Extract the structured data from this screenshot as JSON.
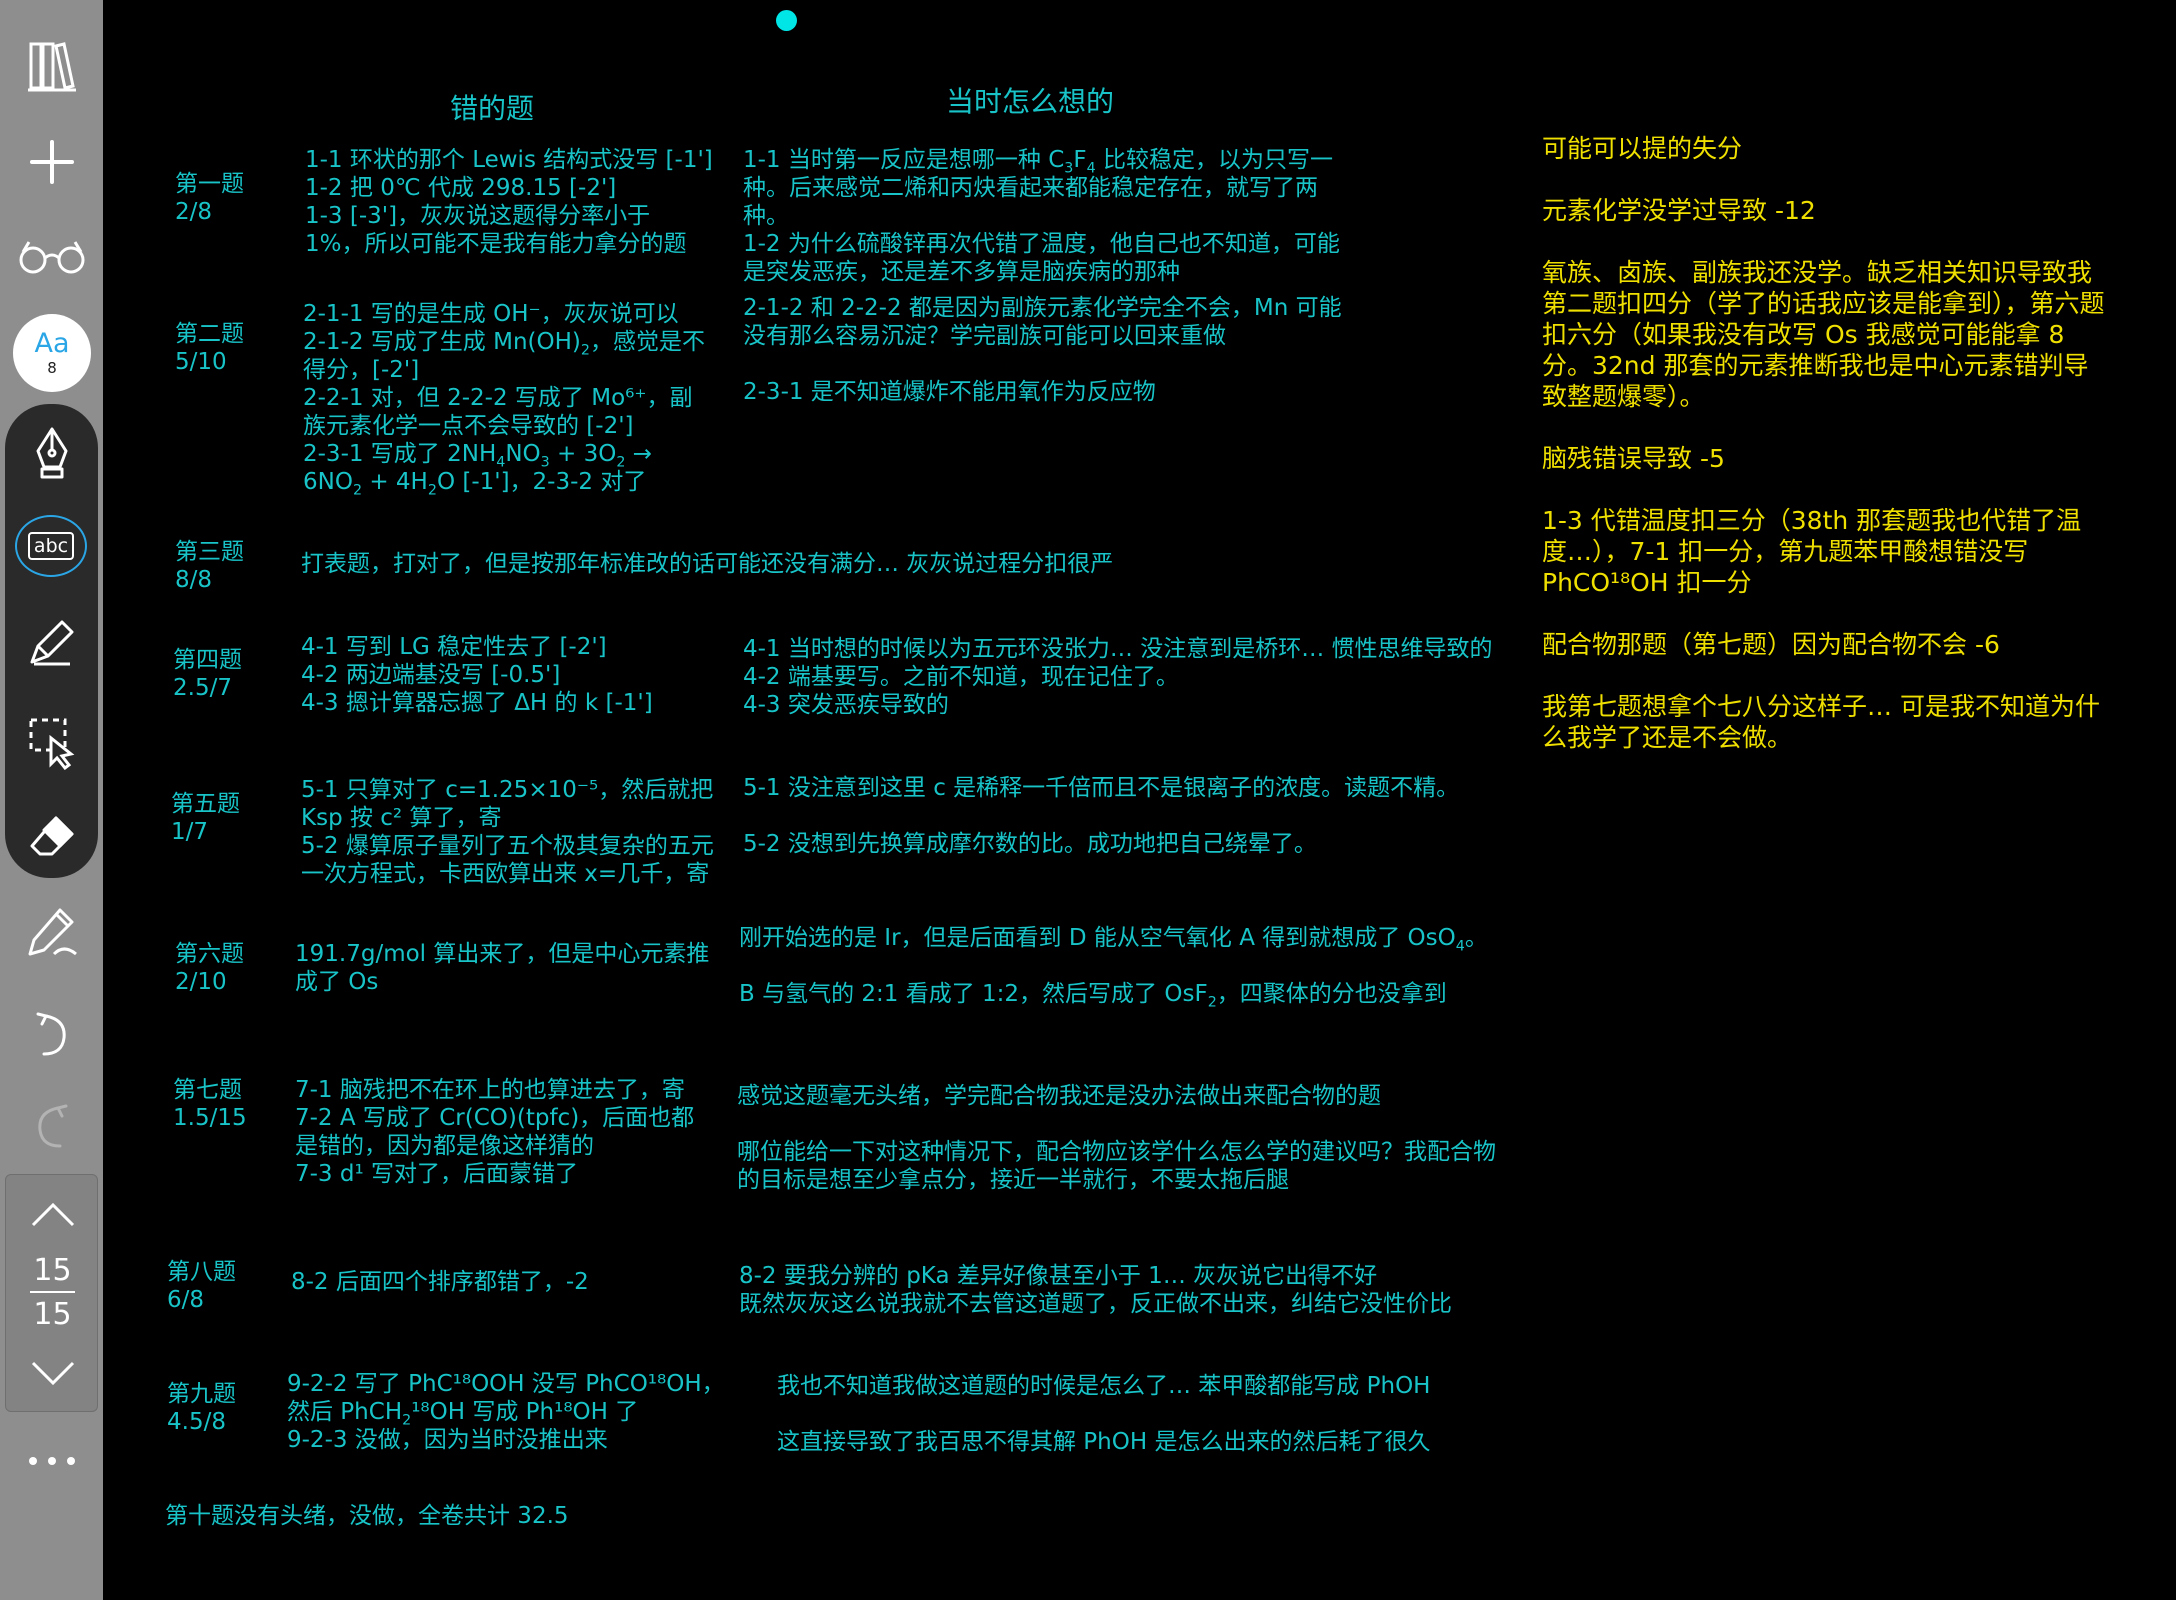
{
  "toolbar": {
    "icons": [
      "library-icon",
      "plus-icon",
      "glasses-icon",
      "text-size-icon",
      "fountain-pen-icon",
      "text-tool-icon",
      "highlighter-icon",
      "lasso-select-icon",
      "eraser-icon",
      "shape-pen-icon",
      "undo-icon",
      "redo-icon",
      "page-up-icon",
      "page-down-icon",
      "more-icon"
    ],
    "text_size_label": "Aa",
    "text_size_value": "8",
    "text_tool_label": "abc",
    "page_current": "15",
    "page_total": "15",
    "accent_color": "#2aa6e6"
  },
  "notes": {
    "header_wrong": "错的题",
    "header_thought": "当时怎么想的",
    "q1": {
      "title": "第一题",
      "score": "2/8",
      "wrong": [
        "1-1 环状的那个 Lewis 结构式没写 [-1']",
        "1-2 把 0℃ 代成 298.15 [-2']",
        "1-3 [-3']，灰灰说这题得分率小于",
        "1%，所以可能不是我有能力拿分的题"
      ],
      "thought_1_pre": "1-1 当时第一反应是想哪一种 C",
      "thought_1_s1": "3",
      "thought_1_mid": "F",
      "thought_1_s2": "4",
      "thought_1_post": " 比较稳定，以为只写一",
      "thought": [
        "种。后来感觉二烯和丙炔看起来都能稳定存在，就写了两",
        "种。",
        "1-2 为什么硫酸锌再次代错了温度，他自己也不知道，可能",
        "是突发恶疾，还是差不多算是脑疾病的那种"
      ]
    },
    "q2": {
      "title": "第二题",
      "score": "5/10",
      "wrong_1": "2-1-1 写的是生成 OH⁻，灰灰说可以",
      "wrong_2_pre": "2-1-2 写成了生成 Mn(OH)",
      "wrong_2_sub": "2",
      "wrong_2_post": "，感觉是不",
      "wrong_3": "得分，[-2']",
      "wrong_4": "2-2-1 对，但 2-2-2 写成了 Mo⁶⁺，副",
      "wrong_5": "族元素化学一点不会导致的 [-2']",
      "wrong_6_a": "2-3-1 写成了 2NH",
      "wrong_6_s1": "4",
      "wrong_6_b": "NO",
      "wrong_6_s2": "3",
      "wrong_6_c": " + 3O",
      "wrong_6_s3": "2",
      "wrong_6_d": " →",
      "wrong_7_a": "6NO",
      "wrong_7_s1": "2",
      "wrong_7_b": " + 4H",
      "wrong_7_s2": "2",
      "wrong_7_c": "O [-1']，2-3-2 对了",
      "thought": [
        "2-1-2 和 2-2-2 都是因为副族元素化学完全不会，Mn 可能",
        "没有那么容易沉淀？学完副族可能可以回来重做",
        "",
        "2-3-1 是不知道爆炸不能用氧作为反应物"
      ]
    },
    "q3": {
      "title": "第三题",
      "score": "8/8",
      "wrong": "打表题，打对了，但是按那年标准改的话可能还没有满分… 灰灰说过程分扣很严"
    },
    "q4": {
      "title": "第四题",
      "score": "2.5/7",
      "wrong": [
        "4-1 写到 LG 稳定性去了 [-2']",
        "4-2 两边端基没写 [-0.5']",
        "4-3 摁计算器忘摁了 ΔH 的 k [-1']"
      ],
      "thought": [
        "4-1 当时想的时候以为五元环没张力… 没注意到是桥环… 惯性思维导致的",
        "4-2 端基要写。之前不知道，现在记住了。",
        "4-3 突发恶疾导致的"
      ]
    },
    "q5": {
      "title": "第五题",
      "score": "1/7",
      "wrong": [
        "5-1 只算对了 c=1.25×10⁻⁵，然后就把",
        "Ksp 按 c² 算了，寄",
        "5-2 爆算原子量列了五个极其复杂的五元",
        "一次方程式，卡西欧算出来 x=几千，寄"
      ],
      "thought": [
        "5-1 没注意到这里 c 是稀释一千倍而且不是银离子的浓度。读题不精。",
        "",
        "5-2 没想到先换算成摩尔数的比。成功地把自己绕晕了。"
      ]
    },
    "q6": {
      "title": "第六题",
      "score": "2/10",
      "wrong": [
        "191.7g/mol 算出来了，但是中心元素推",
        "成了 Os"
      ],
      "thought_1_pre": "刚开始选的是 Ir，但是后面看到 D 能从空气氧化 A 得到就想成了 OsO",
      "thought_1_sub": "4",
      "thought_1_post": "。",
      "thought_2_pre": "B 与氢气的 2:1 看成了 1:2，然后写成了 OsF",
      "thought_2_sub": "2",
      "thought_2_post": "，四聚体的分也没拿到"
    },
    "q7": {
      "title": "第七题",
      "score": "1.5/15",
      "wrong": [
        "7-1 脑残把不在环上的也算进去了，寄",
        "7-2 A 写成了 Cr(CO)(tpfc)，后面也都",
        "是错的，因为都是像这样猜的",
        "7-3 d¹ 写对了，后面蒙错了"
      ],
      "thought": [
        "感觉这题毫无头绪，学完配合物我还是没办法做出来配合物的题",
        "",
        "哪位能给一下对这种情况下，配合物应该学什么怎么学的建议吗？我配合物",
        "的目标是想至少拿点分，接近一半就行，不要太拖后腿"
      ]
    },
    "q8": {
      "title": "第八题",
      "score": "6/8",
      "wrong": "8-2 后面四个排序都错了，-2",
      "thought": [
        "8-2 要我分辨的 pKa 差异好像甚至小于 1… 灰灰说它出得不好",
        "既然灰灰这么说我就不去管这道题了，反正做不出来，纠结它没性价比"
      ]
    },
    "q9": {
      "title": "第九题",
      "score": "4.5/8",
      "wrong_1": "9-2-2 写了 PhC¹⁸OOH 没写 PhCO¹⁸OH，",
      "wrong_2_pre": "然后 PhCH",
      "wrong_2_sub": "2",
      "wrong_2_post": "¹⁸OH 写成 Ph¹⁸OH 了",
      "wrong_3": "9-2-3 没做，因为当时没推出来",
      "thought": [
        "我也不知道我做这道题的时候是怎么了… 苯甲酸都能写成 PhOH",
        "",
        "这直接导致了我百思不得其解 PhOH 是怎么出来的然后耗了很久"
      ]
    },
    "q10": "第十题没有头绪，没做，全卷共计 32.5"
  },
  "analysis": {
    "lines": [
      "可能可以提的失分",
      "",
      "元素化学没学过导致 -12",
      "",
      "氧族、卤族、副族我还没学。缺乏相关知识导致我",
      "第二题扣四分（学了的话我应该是能拿到），第六题",
      "扣六分（如果我没有改写 Os 我感觉可能能拿 8",
      "分。32nd 那套的元素推断我也是中心元素错判导",
      "致整题爆零）。",
      "",
      "脑残错误导致 -5",
      "",
      "1-3 代错温度扣三分（38th 那套题我也代错了温",
      "度…），7-1 扣一分，第九题苯甲酸想错没写",
      "PhCO¹⁸OH 扣一分",
      "",
      "配合物那题（第七题）因为配合物不会 -6",
      "",
      "我第七题想拿个七八分这样子… 可是我不知道为什",
      "么我学了还是不会做。"
    ]
  }
}
